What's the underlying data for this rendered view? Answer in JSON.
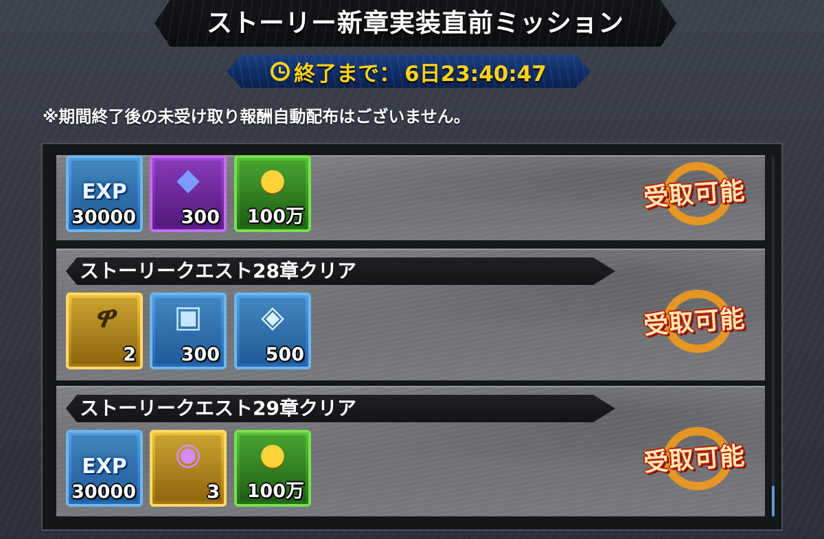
{
  "header": {
    "title": "ストーリー新章実装直前ミッション",
    "timer_label": "終了まで：",
    "timer_value": "6日23:40:47"
  },
  "notice": "※期間終了後の未受け取り報酬自動配布はございません。",
  "missions": [
    {
      "title": "",
      "status": "受取可能",
      "rewards": [
        {
          "icon": "exp-icon",
          "count": "30000",
          "frame": "blue"
        },
        {
          "icon": "gem-chest-icon",
          "count": "300",
          "frame": "purple"
        },
        {
          "icon": "gold-coins-icon",
          "count": "100万",
          "frame": "green"
        }
      ]
    },
    {
      "title": "ストーリークエスト28章クリア",
      "status": "受取可能",
      "rewards": [
        {
          "icon": "scroll-token-icon",
          "count": "2",
          "frame": "gold"
        },
        {
          "icon": "treasure-chest-icon",
          "count": "300",
          "frame": "blue"
        },
        {
          "icon": "crystal-potion-icon",
          "count": "500",
          "frame": "blue"
        }
      ]
    },
    {
      "title": "ストーリークエスト29章クリア",
      "status": "受取可能",
      "rewards": [
        {
          "icon": "exp-icon",
          "count": "30000",
          "frame": "blue"
        },
        {
          "icon": "magic-orb-icon",
          "count": "3",
          "frame": "gold"
        },
        {
          "icon": "gold-coins-icon",
          "count": "100万",
          "frame": "green"
        }
      ]
    }
  ],
  "colors": {
    "timer_text": "#ffd21a",
    "stamp_ring": "#f39a1c",
    "scroll_thumb": "#5a9ad8"
  }
}
